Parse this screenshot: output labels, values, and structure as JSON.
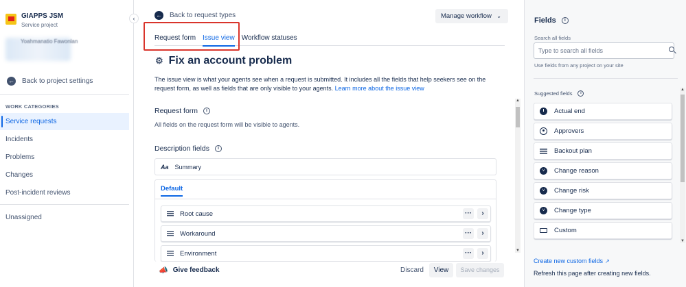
{
  "sidebar": {
    "project_name": "GIAPPS JSM",
    "project_type": "Service project",
    "blurred_text": "Yoahmanatio Fawonlan",
    "back_label": "Back to project settings",
    "section_label": "WORK CATEGORIES",
    "items": [
      {
        "label": "Service requests",
        "active": true
      },
      {
        "label": "Incidents"
      },
      {
        "label": "Problems"
      },
      {
        "label": "Changes"
      },
      {
        "label": "Post-incident reviews"
      }
    ],
    "unassigned_label": "Unassigned"
  },
  "main": {
    "back_label": "Back to request types",
    "manage_workflow": "Manage workflow",
    "tabs": [
      {
        "label": "Request form"
      },
      {
        "label": "Issue view",
        "active": true
      },
      {
        "label": "Workflow statuses"
      }
    ],
    "title": "Fix an account problem",
    "description": "The issue view is what your agents see when a request is submitted. It includes all the fields that help seekers see on the request form, as well as fields that are only visible to your agents.",
    "learn_more": "Learn more about the issue view",
    "request_form_title": "Request form",
    "request_form_sub": "All fields on the request form will be visible to agents.",
    "description_fields_title": "Description fields",
    "summary_label": "Summary",
    "summary_icon": "Aa",
    "default_tab": "Default",
    "fields": [
      {
        "label": "Root cause"
      },
      {
        "label": "Workaround"
      },
      {
        "label": "Environment"
      }
    ],
    "more_icon": "···",
    "give_feedback": "Give feedback",
    "discard": "Discard",
    "view": "View",
    "save_changes": "Save changes"
  },
  "right_panel": {
    "title": "Fields",
    "search_label": "Search all fields",
    "search_placeholder": "Type to search all fields",
    "search_hint": "Use fields from any project on your site",
    "suggested_label": "Suggested fields",
    "suggested": [
      {
        "label": "Actual end",
        "icon": "clock-icon"
      },
      {
        "label": "Approvers",
        "icon": "person-icon"
      },
      {
        "label": "Backout plan",
        "icon": "paragraph-icon"
      },
      {
        "label": "Change reason",
        "icon": "dropdown-icon"
      },
      {
        "label": "Change risk",
        "icon": "dropdown-icon"
      },
      {
        "label": "Change type",
        "icon": "dropdown-icon"
      },
      {
        "label": "Custom",
        "icon": "text-field-icon"
      }
    ],
    "create_link": "Create new custom fields",
    "refresh_note": "Refresh this page after creating new fields."
  },
  "colors": {
    "accent": "#0c66e4",
    "highlight_box": "#d9342b",
    "text": "#172b4d"
  }
}
